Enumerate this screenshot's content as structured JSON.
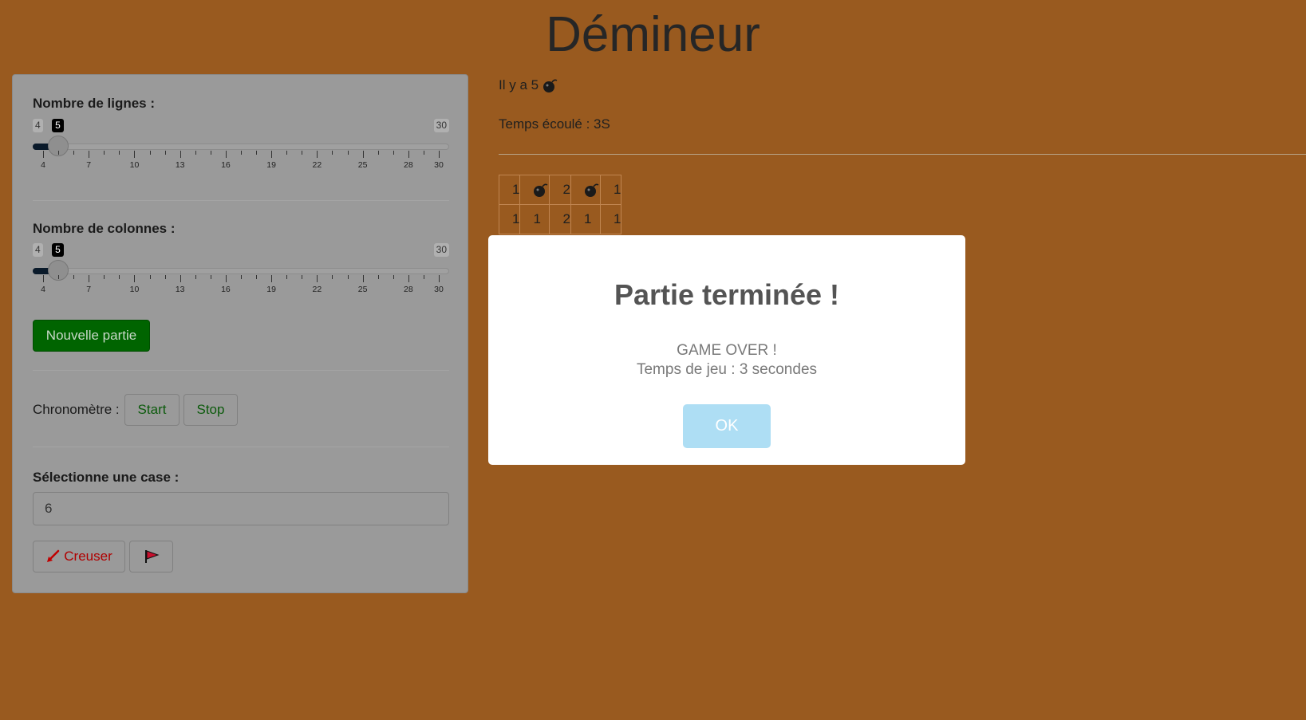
{
  "title": "Démineur",
  "sidebar": {
    "rows_slider": {
      "label": "Nombre de lignes :",
      "min": "4",
      "max": "30",
      "value": "5",
      "value_fraction": 0.0385,
      "tick_labels": [
        "4",
        "7",
        "10",
        "13",
        "16",
        "19",
        "22",
        "25",
        "28",
        "30"
      ]
    },
    "cols_slider": {
      "label": "Nombre de colonnes :",
      "min": "4",
      "max": "30",
      "value": "5",
      "value_fraction": 0.0385,
      "tick_labels": [
        "4",
        "7",
        "10",
        "13",
        "16",
        "19",
        "22",
        "25",
        "28",
        "30"
      ]
    },
    "new_game_label": "Nouvelle partie",
    "chrono_label": "Chronomètre :",
    "start_label": "Start",
    "stop_label": "Stop",
    "select_cell_label": "Sélectionne une case :",
    "select_cell_value": "6",
    "dig_label": "Creuser",
    "dig_icon": "shovel-icon",
    "flag_icon": "flag-icon"
  },
  "main": {
    "mine_count_text": "Il y a 5",
    "mine_icon": "bomb-icon",
    "elapsed_text": "Temps écoulé : 3S",
    "grid": [
      [
        "1",
        "bomb",
        "2",
        "bomb",
        "1"
      ],
      [
        "1",
        "1",
        "2",
        "1",
        "1"
      ]
    ]
  },
  "modal": {
    "title": "Partie terminée !",
    "line1": "GAME OVER !",
    "line2": "Temps de jeu : 3 secondes",
    "ok_label": "OK"
  },
  "colors": {
    "background": "#995a1f",
    "new_game_button": "#006400",
    "ok_button": "#aedef4"
  }
}
